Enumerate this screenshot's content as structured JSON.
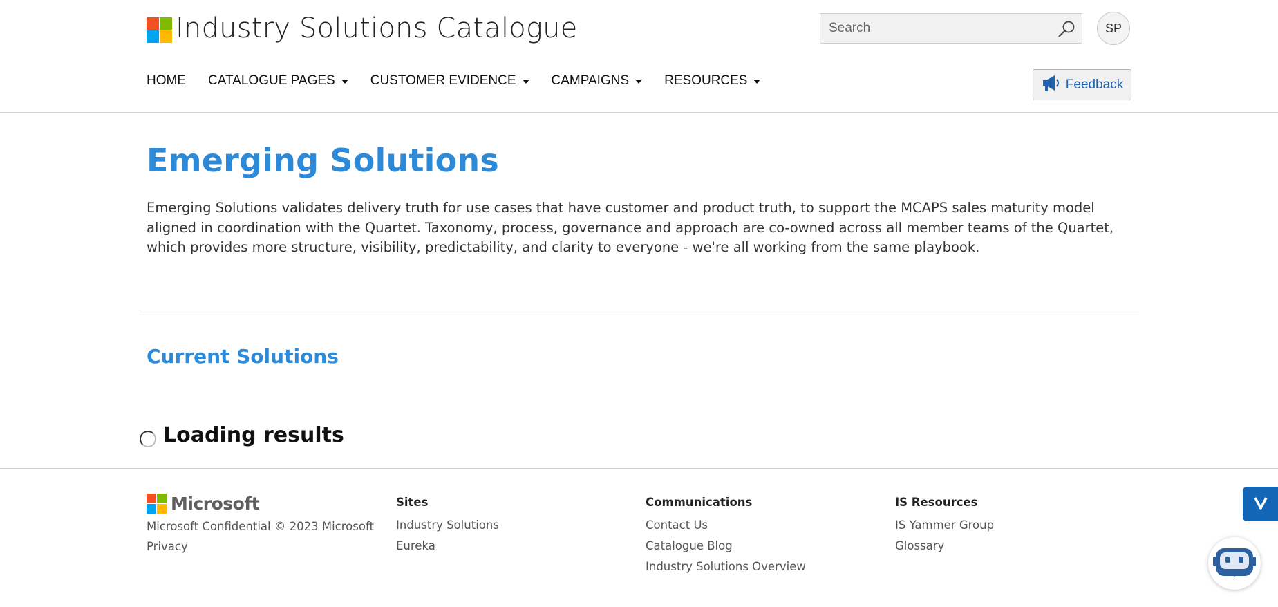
{
  "header": {
    "site_title": "Industry Solutions Catalogue",
    "logo_colors": [
      "#f25022",
      "#7fba00",
      "#00a4ef",
      "#ffb900"
    ],
    "search": {
      "placeholder": "Search",
      "value": ""
    },
    "avatar_initials": "SP",
    "feedback_label": "Feedback"
  },
  "nav": {
    "items": [
      {
        "label": "HOME",
        "has_dropdown": false
      },
      {
        "label": "CATALOGUE PAGES",
        "has_dropdown": true
      },
      {
        "label": "CUSTOMER EVIDENCE",
        "has_dropdown": true
      },
      {
        "label": "CAMPAIGNS",
        "has_dropdown": true
      },
      {
        "label": "RESOURCES",
        "has_dropdown": true
      }
    ]
  },
  "main": {
    "title": "Emerging Solutions",
    "description": "Emerging Solutions validates delivery truth for use cases that have customer and product truth, to support the MCAPS sales maturity model aligned in coordination with the Quartet. Taxonomy, process, governance and approach are co-owned across all member teams of the Quartet, which provides more structure, visibility, predictability, and clarity to everyone - we're all working from the same playbook.",
    "section_title": "Current Solutions",
    "loading_text": "Loading results",
    "accent_color": "#2d8ad8"
  },
  "footer": {
    "brand": "Microsoft",
    "copyright": "Microsoft Confidential © 2023 Microsoft",
    "privacy": "Privacy",
    "columns": [
      {
        "heading": "Sites",
        "links": [
          "Industry Solutions",
          "Eureka"
        ]
      },
      {
        "heading": "Communications",
        "links": [
          "Contact Us",
          "Catalogue Blog",
          "Industry Solutions Overview"
        ]
      },
      {
        "heading": "IS Resources",
        "links": [
          "IS Yammer Group",
          "Glossary"
        ]
      }
    ]
  },
  "widgets": {
    "side_tab_icon": "chevron-down-icon",
    "chatbot_icon": "robot-icon",
    "side_tab_color": "#1366b6"
  }
}
